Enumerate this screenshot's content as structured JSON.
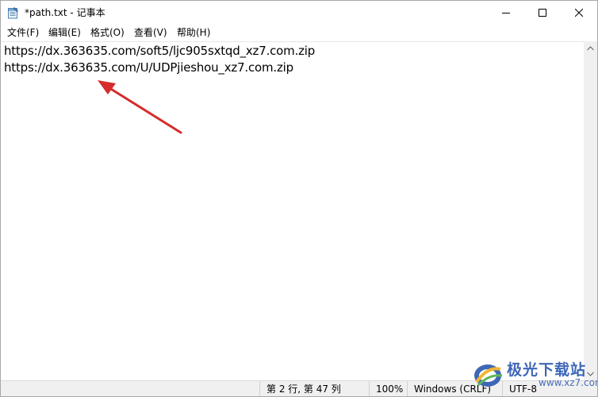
{
  "window": {
    "title": "*path.txt - 记事本",
    "icon": "notepad-icon"
  },
  "menu": {
    "items": [
      "文件(F)",
      "编辑(E)",
      "格式(O)",
      "查看(V)",
      "帮助(H)"
    ]
  },
  "editor": {
    "lines": [
      "https://dx.363635.com/soft5/ljc905sxtqd_xz7.com.zip",
      "https://dx.363635.com/U/UDPjieshou_xz7.com.zip"
    ]
  },
  "status": {
    "position": "第 2 行, 第 47 列",
    "zoom": "100%",
    "line_ending": "Windows (CRLF)",
    "encoding": "UTF-8"
  },
  "annotation": {
    "arrow_color": "#d62b2b"
  },
  "watermark": {
    "brand": "极光下载站",
    "url": "www.xz7.com"
  }
}
